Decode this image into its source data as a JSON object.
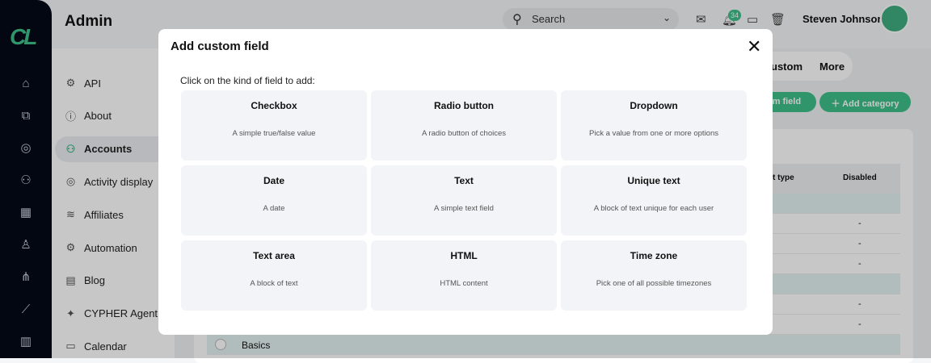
{
  "header": {
    "title": "Admin",
    "search_placeholder": "Search",
    "notifications_count": "34",
    "user_name": "Steven Johnson"
  },
  "logo": "cl",
  "subnav": [
    {
      "label": "API",
      "icon": "gear-icon"
    },
    {
      "label": "About",
      "icon": "info-icon"
    },
    {
      "label": "Accounts",
      "icon": "users-icon",
      "active": true
    },
    {
      "label": "Activity display",
      "icon": "target-icon"
    },
    {
      "label": "Affiliates",
      "icon": "handshake-icon"
    },
    {
      "label": "Automation",
      "icon": "gear-icon"
    },
    {
      "label": "Blog",
      "icon": "document-icon"
    },
    {
      "label": "CYPHER Agent",
      "icon": "sparkle-icon"
    },
    {
      "label": "Calendar",
      "icon": "calendar-icon"
    }
  ],
  "tabs": {
    "custom": "ustom",
    "more": "More"
  },
  "buttons": {
    "add_custom_field": "om field",
    "add_category": "Add category"
  },
  "table": {
    "col_type": "t type",
    "col_disabled": "Disabled",
    "dash": "-",
    "basics": "Basics"
  },
  "modal": {
    "title": "Add custom field",
    "prompt": "Click on the kind of field to add:",
    "options": [
      {
        "title": "Checkbox",
        "desc": "A simple true/false value"
      },
      {
        "title": "Radio button",
        "desc": "A radio button of choices"
      },
      {
        "title": "Dropdown",
        "desc": "Pick a value from one or more options"
      },
      {
        "title": "Date",
        "desc": "A date"
      },
      {
        "title": "Text",
        "desc": "A simple text field"
      },
      {
        "title": "Unique text",
        "desc": "A block of text unique for each user"
      },
      {
        "title": "Text area",
        "desc": "A block of text"
      },
      {
        "title": "HTML",
        "desc": "HTML content"
      },
      {
        "title": "Time zone",
        "desc": "Pick one of all possible timezones"
      }
    ]
  },
  "colors": {
    "accent": "#3fbf8a",
    "rail": "#050a18"
  }
}
